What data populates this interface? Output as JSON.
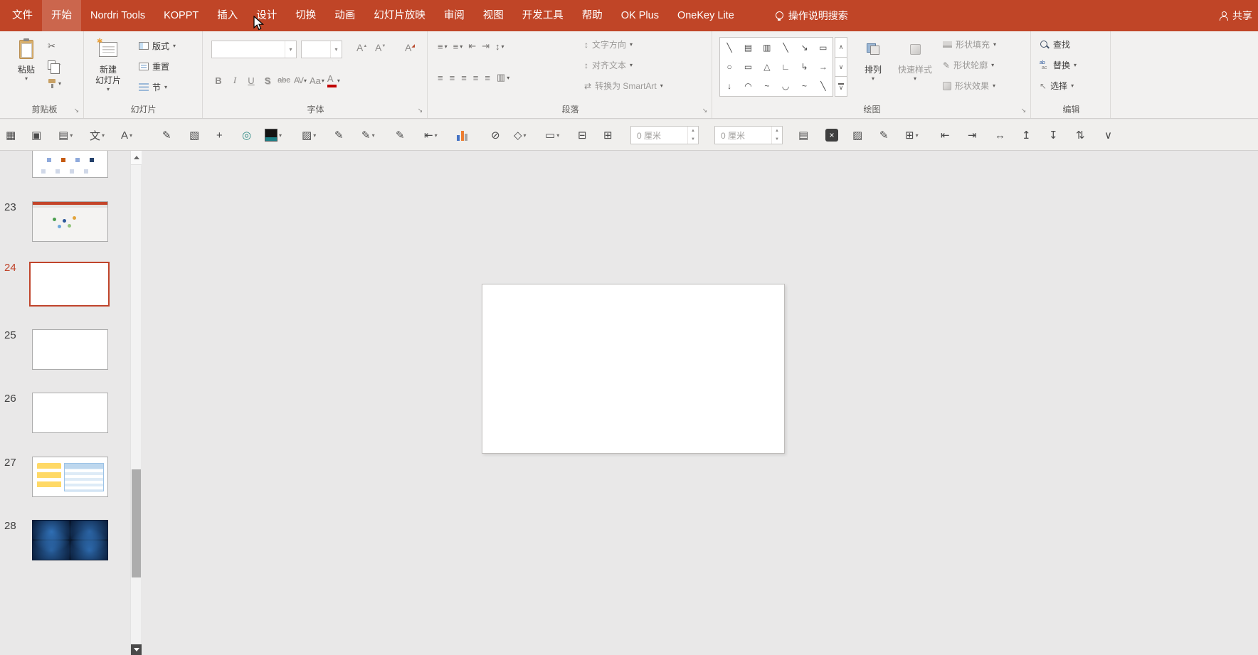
{
  "colors": {
    "titlebar": "#C04527",
    "selection": "#C0442B",
    "ribbon_bg": "#F2F1F0",
    "workspace_bg": "#E9E8E8"
  },
  "titlebar": {
    "tabs": [
      {
        "id": "file",
        "label": "文件"
      },
      {
        "id": "home",
        "label": "开始",
        "active": true
      },
      {
        "id": "nordri-tools",
        "label": "Nordri Tools"
      },
      {
        "id": "koppt",
        "label": "KOPPT"
      },
      {
        "id": "insert",
        "label": "插入"
      },
      {
        "id": "design",
        "label": "设计"
      },
      {
        "id": "transitions",
        "label": "切换"
      },
      {
        "id": "animations",
        "label": "动画"
      },
      {
        "id": "slideshow",
        "label": "幻灯片放映"
      },
      {
        "id": "review",
        "label": "审阅"
      },
      {
        "id": "view",
        "label": "视图"
      },
      {
        "id": "developer",
        "label": "开发工具"
      },
      {
        "id": "help",
        "label": "帮助"
      },
      {
        "id": "ok-plus",
        "label": "OK Plus"
      },
      {
        "id": "onekey-lite",
        "label": "OneKey Lite"
      }
    ],
    "search": "操作说明搜索",
    "share": "共享"
  },
  "icons": {
    "dropdown": "▾",
    "dialog_launcher": "↘",
    "cut": "✂",
    "grow_font": "A",
    "shrink_font": "A",
    "clear_format": "A",
    "bullets": "≡",
    "numbering": "≡",
    "indent_decrease": "⇤",
    "indent_increase": "⇥",
    "line_spacing": "↕",
    "align_left": "≡",
    "align_center": "≡",
    "align_right": "≡",
    "justify": "≡",
    "distribute": "≡",
    "columns": "▥",
    "text_direction": "↕",
    "align_text": "↕",
    "smartart": "⇄",
    "select": "↖",
    "replace_top": "ab",
    "replace_bottom": "ac",
    "gallery_up": "∧",
    "gallery_down": "∨",
    "gallery_more": "∨",
    "spin_up": "▲",
    "spin_down": "▼"
  },
  "ribbon": {
    "clipboard": {
      "label": "剪贴板",
      "paste": "粘贴"
    },
    "slides": {
      "label": "幻灯片",
      "new_line1": "新建",
      "new_line2": "幻灯片",
      "layout": "版式",
      "reset": "重置",
      "section": "节"
    },
    "font": {
      "label": "字体",
      "font_name": "",
      "font_size": "",
      "bold": "B",
      "italic": "I",
      "underline": "U",
      "shadow": "S",
      "strikethrough": "abc",
      "char_spacing": "AV",
      "change_case": "Aa",
      "font_color": "A"
    },
    "paragraph": {
      "label": "段落",
      "text_direction": "文字方向",
      "align_text": "对齐文本",
      "smartart": "转换为 SmartArt"
    },
    "drawing": {
      "label": "绘图",
      "arrange": "排列",
      "quick_styles": "快速样式",
      "shape_fill": "形状填充",
      "shape_outline": "形状轮廓",
      "shape_effects": "形状效果",
      "shapes": [
        {
          "name": "line-shape",
          "glyph": "╲"
        },
        {
          "name": "text-box-shape",
          "glyph": "▤"
        },
        {
          "name": "vertical-text-box-shape",
          "glyph": "▥"
        },
        {
          "name": "line-shape-2",
          "glyph": "╲"
        },
        {
          "name": "arrow-line-shape",
          "glyph": "↘"
        },
        {
          "name": "rectangle-shape",
          "glyph": "▭"
        },
        {
          "name": "oval-shape",
          "glyph": "○"
        },
        {
          "name": "rounded-rectangle-shape",
          "glyph": "▭"
        },
        {
          "name": "triangle-shape",
          "glyph": "△"
        },
        {
          "name": "elbow-connector-shape",
          "glyph": "∟"
        },
        {
          "name": "elbow-arrow-connector-shape",
          "glyph": "↳"
        },
        {
          "name": "right-arrow-shape",
          "glyph": "→"
        },
        {
          "name": "down-arrow-shape",
          "glyph": "↓"
        },
        {
          "name": "freeform-shape",
          "glyph": "◠"
        },
        {
          "name": "scribble-shape",
          "glyph": "~"
        },
        {
          "name": "arc-shape",
          "glyph": "◡"
        },
        {
          "name": "curve-shape",
          "glyph": "~"
        },
        {
          "name": "line-shape-3",
          "glyph": "╲"
        }
      ]
    },
    "editing": {
      "label": "编辑",
      "find": "查找",
      "replace": "替换",
      "select": "选择"
    }
  },
  "toolbar2": {
    "items": [
      {
        "name": "normal-view-icon",
        "glyph": "▦",
        "type": "icon"
      },
      {
        "name": "slide-master-icon",
        "glyph": "▣",
        "type": "icon"
      },
      {
        "name": "text-box-tool",
        "glyph": "▤",
        "type": "drop"
      },
      {
        "name": "vertical-text-tool",
        "glyph": "文",
        "type": "drop"
      },
      {
        "name": "font-format-tool",
        "glyph": "A",
        "type": "drop"
      },
      {
        "name": "format-brush-icon",
        "glyph": "✎",
        "type": "icon"
      },
      {
        "name": "insert-picture-icon",
        "glyph": "▧",
        "type": "icon"
      },
      {
        "name": "anchor-icon",
        "glyph": "+",
        "type": "icon"
      },
      {
        "name": "ellipse-tool-icon",
        "glyph": "◎",
        "type": "icon",
        "color": "#2E8B85"
      },
      {
        "name": "theme-color-swatch",
        "type": "swatch"
      },
      {
        "name": "fill-color-tool",
        "glyph": "▨",
        "type": "drop"
      },
      {
        "name": "eyedropper-icon",
        "glyph": "✎",
        "type": "icon"
      },
      {
        "name": "outline-pen-tool",
        "glyph": "✎",
        "type": "drop"
      },
      {
        "name": "highlight-pen-icon",
        "glyph": "✎",
        "type": "icon"
      },
      {
        "name": "object-align-tool",
        "glyph": "⇤",
        "type": "drop"
      },
      {
        "name": "chart-tool-icon",
        "type": "chart"
      },
      {
        "name": "no-fill-icon",
        "glyph": "⊘",
        "type": "icon"
      },
      {
        "name": "shape-picker-tool",
        "glyph": "◇",
        "type": "drop"
      },
      {
        "name": "skew-tool",
        "glyph": "▭",
        "type": "drop"
      },
      {
        "name": "position-tool-1",
        "glyph": "⊟",
        "type": "icon"
      },
      {
        "name": "position-tool-2",
        "glyph": "⊞",
        "type": "icon"
      },
      {
        "name": "width-spinner",
        "type": "spinner",
        "value": "0 厘米"
      },
      {
        "name": "height-spinner",
        "type": "spinner",
        "value": "0 厘米"
      },
      {
        "name": "keyboard-icon",
        "glyph": "▤",
        "type": "icon"
      },
      {
        "name": "delete-tool",
        "glyph": "×",
        "type": "dark"
      },
      {
        "name": "paste-special-icon",
        "glyph": "▨",
        "type": "icon"
      },
      {
        "name": "format-paint-icon",
        "glyph": "✎",
        "type": "icon"
      },
      {
        "name": "border-tool",
        "glyph": "⊞",
        "type": "drop"
      },
      {
        "name": "align-objects-left-icon",
        "glyph": "⇤",
        "type": "icon"
      },
      {
        "name": "align-objects-right-icon",
        "glyph": "⇥",
        "type": "icon"
      },
      {
        "name": "distribute-horizontal-icon",
        "glyph": "↔",
        "type": "icon"
      },
      {
        "name": "align-objects-top-icon",
        "glyph": "↥",
        "type": "icon"
      },
      {
        "name": "align-objects-bottom-icon",
        "glyph": "↧",
        "type": "icon"
      },
      {
        "name": "distribute-vertical-icon",
        "glyph": "⇅",
        "type": "icon"
      },
      {
        "name": "toolbar-more-chevron",
        "glyph": "∨",
        "type": "icon"
      }
    ]
  },
  "slide_panel": {
    "slides": [
      {
        "number": "",
        "kind": "diagram-partial"
      },
      {
        "number": "23",
        "kind": "screenshot"
      },
      {
        "number": "24",
        "kind": "blank",
        "selected": true
      },
      {
        "number": "25",
        "kind": "blank"
      },
      {
        "number": "26",
        "kind": "blank"
      },
      {
        "number": "27",
        "kind": "table"
      },
      {
        "number": "28",
        "kind": "dark"
      }
    ]
  }
}
